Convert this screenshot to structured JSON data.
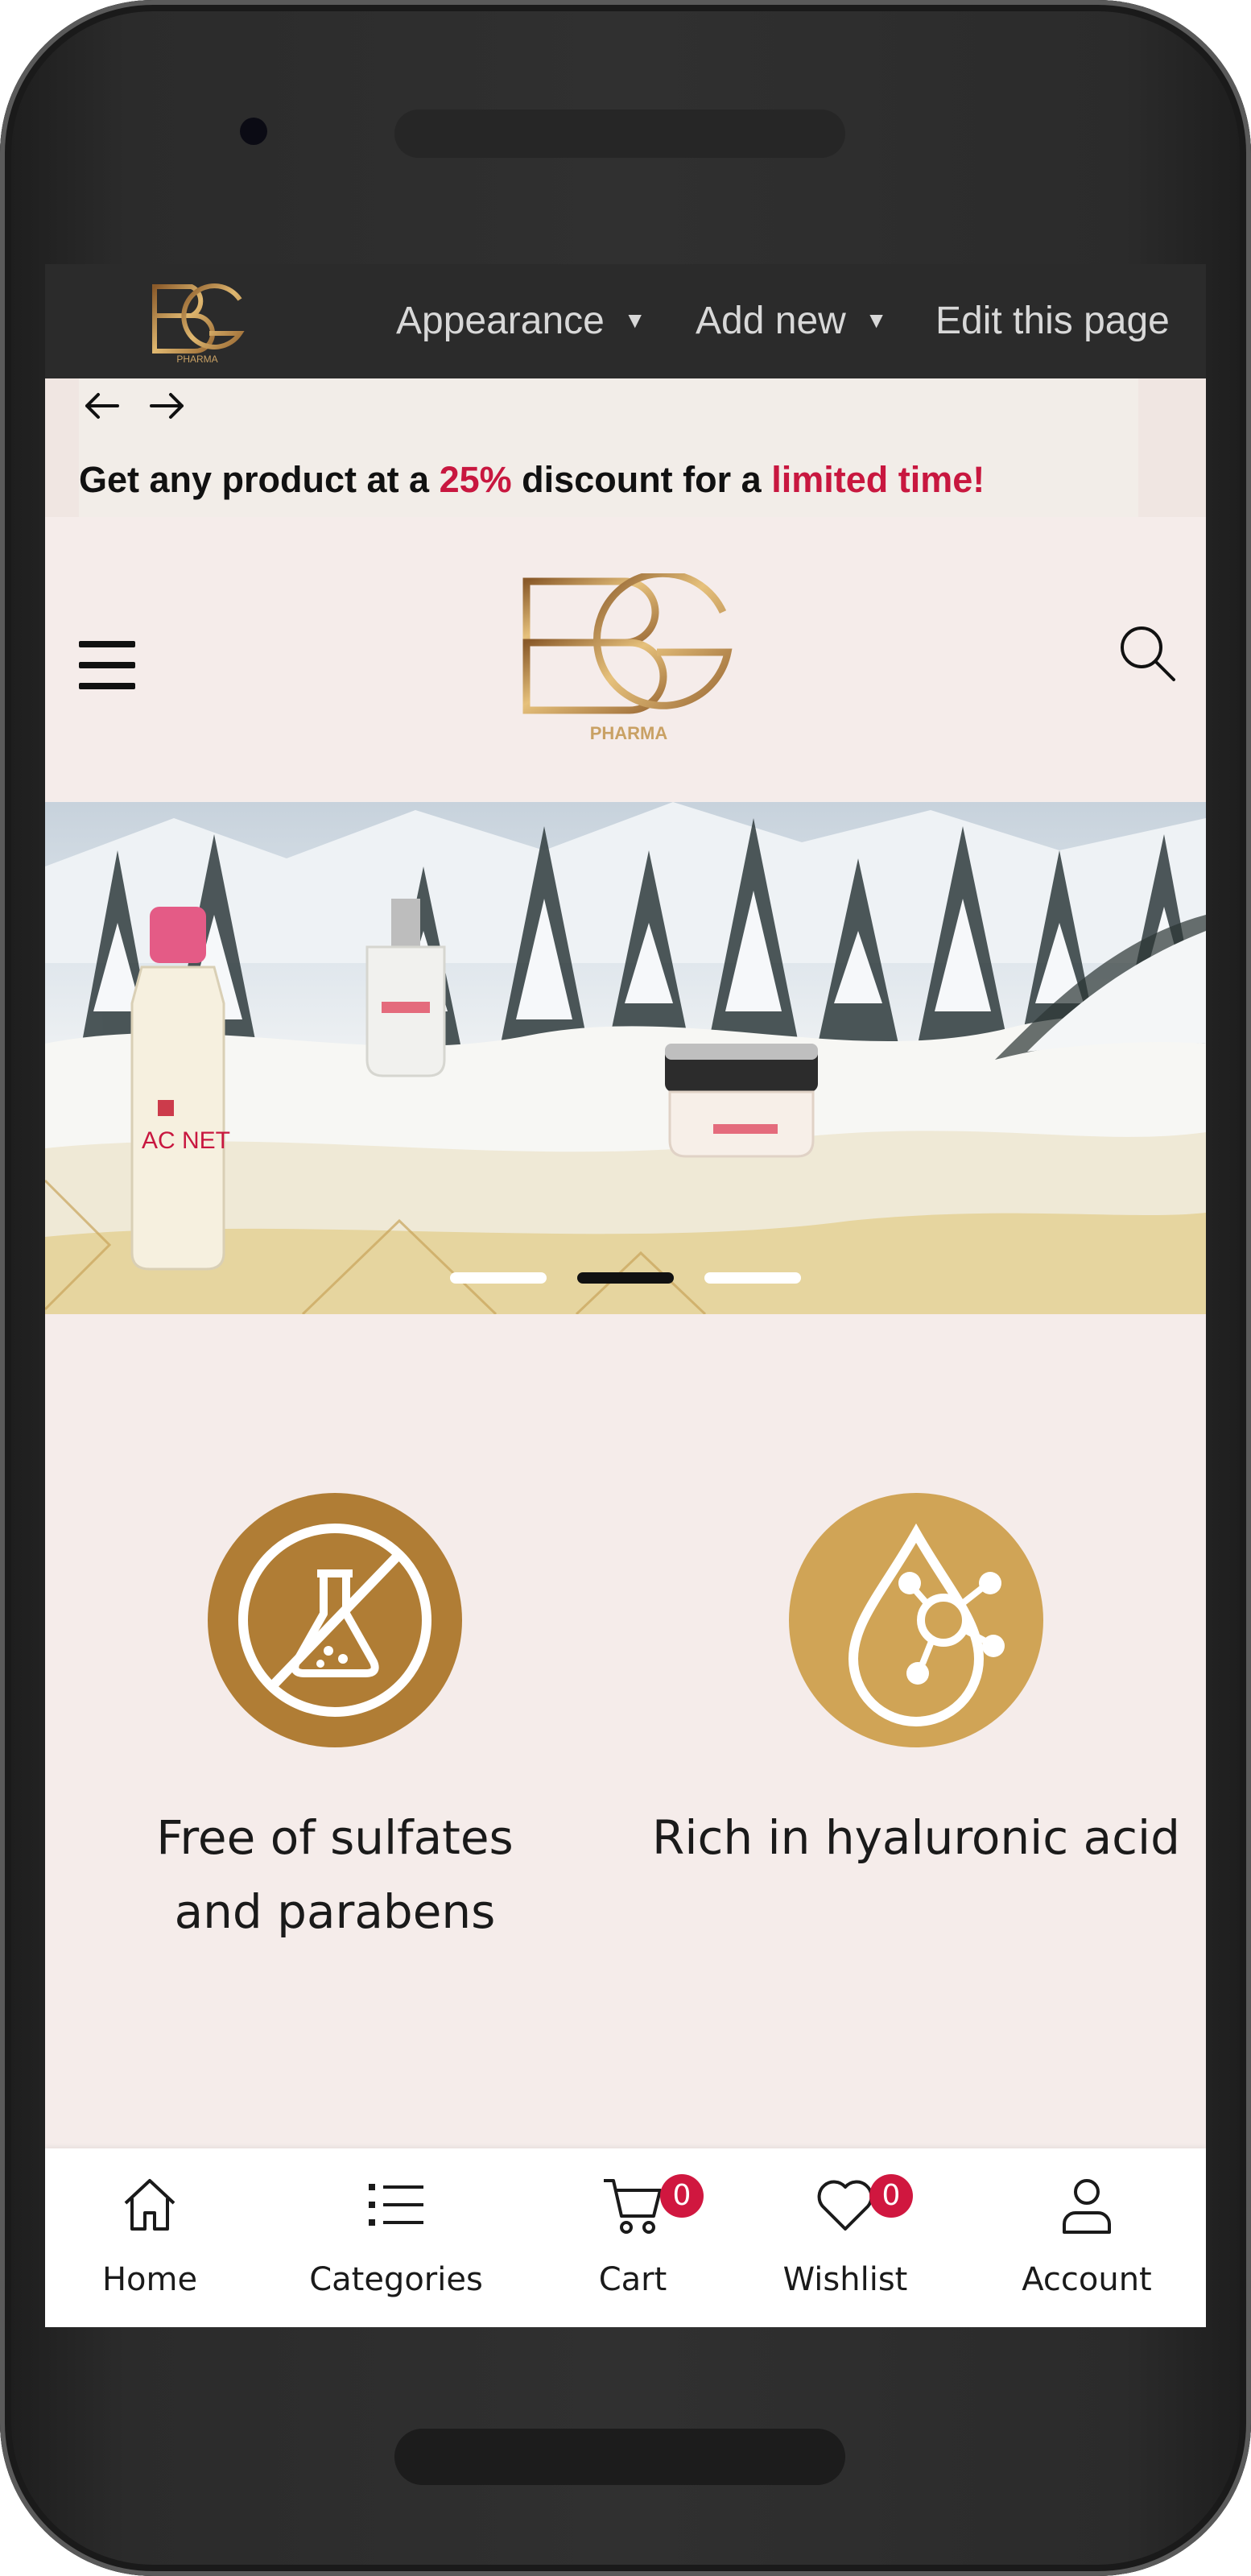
{
  "admin_bar": {
    "menu": [
      {
        "label": "Appearance",
        "dropdown": true
      },
      {
        "label": "Add new",
        "dropdown": true
      },
      {
        "label": "Edit this page",
        "dropdown": false
      }
    ]
  },
  "logo": {
    "text": "PHARMA"
  },
  "promo": {
    "prefix": "Get any product at a ",
    "discount": "25%",
    "middle": " discount for a ",
    "limited": "limited time!",
    "highlight_color": "#c8173f"
  },
  "banner": {
    "slides": 3,
    "active_slide": 2
  },
  "features": [
    {
      "label": "Free of sulfates and parabens",
      "icon": "no-chemicals-icon",
      "color": "#b07d35"
    },
    {
      "label": "Rich in hyaluronic acid",
      "icon": "hyaluronic-drop-icon",
      "color": "#d0a456"
    }
  ],
  "bottom_nav": [
    {
      "label": "Home",
      "icon": "home-icon"
    },
    {
      "label": "Categories",
      "icon": "list-icon"
    },
    {
      "label": "Cart",
      "icon": "cart-icon",
      "badge": "0"
    },
    {
      "label": "Wishlist",
      "icon": "heart-icon",
      "badge": "0"
    },
    {
      "label": "Account",
      "icon": "user-icon"
    }
  ],
  "colors": {
    "accent": "#c8173f",
    "gold": "#b07d35",
    "page_bg": "#f5ecea",
    "admin_bar": "#2b2b2b"
  }
}
